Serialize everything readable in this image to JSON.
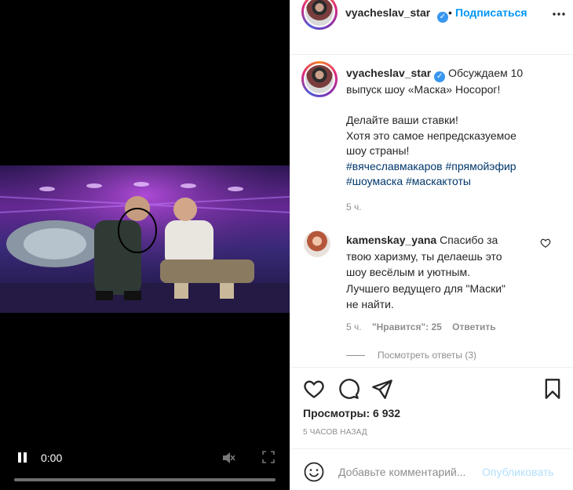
{
  "video": {
    "time": "0:00",
    "progress": 0,
    "icons": [
      "pause-icon",
      "mute-icon",
      "fullscreen-icon"
    ]
  },
  "header": {
    "username": "vyacheslav_star",
    "separator": "•",
    "follow_label": "Подписаться",
    "icons": [
      "verified-icon",
      "more-icon"
    ]
  },
  "caption": {
    "username": "vyacheslav_star",
    "text_lines": [
      "Обсуждаем 10",
      "выпуск шоу «Маска» Носорог!",
      "",
      "Делайте ваши ставки!",
      "Хотя это самое непредсказуемое",
      "шоу страны!"
    ],
    "hashtags_line1": [
      "#вячеславмакаров",
      "#прямойэфир"
    ],
    "hashtags_line2": [
      "#шоумаска",
      "#маскактоты"
    ],
    "time": "5 ч."
  },
  "comment": {
    "username": "kamenskay_yana",
    "text_lines": [
      "Спасибо за",
      "твою харизму, ты делаешь это",
      "шоу весёлым и уютным.",
      "Лучшего ведущего для \"Маски\"",
      "не найти."
    ],
    "time": "5 ч.",
    "likes": "\"Нравится\": 25",
    "reply_label": "Ответить",
    "view_replies": "Посмотреть ответы (3)"
  },
  "actions": {
    "views": "Просмотры: 6 932",
    "posted": "5 ЧАСОВ НАЗАД",
    "icons": [
      "heart-icon",
      "comment-icon",
      "share-icon",
      "bookmark-icon"
    ]
  },
  "comment_box": {
    "placeholder": "Добавьте комментарий...",
    "publish_label": "Опубликовать"
  },
  "colors": {
    "accent": "#0095f6",
    "hashtag": "#00376b",
    "muted": "#8e8e8e",
    "publish_disabled": "#b2dffc"
  }
}
